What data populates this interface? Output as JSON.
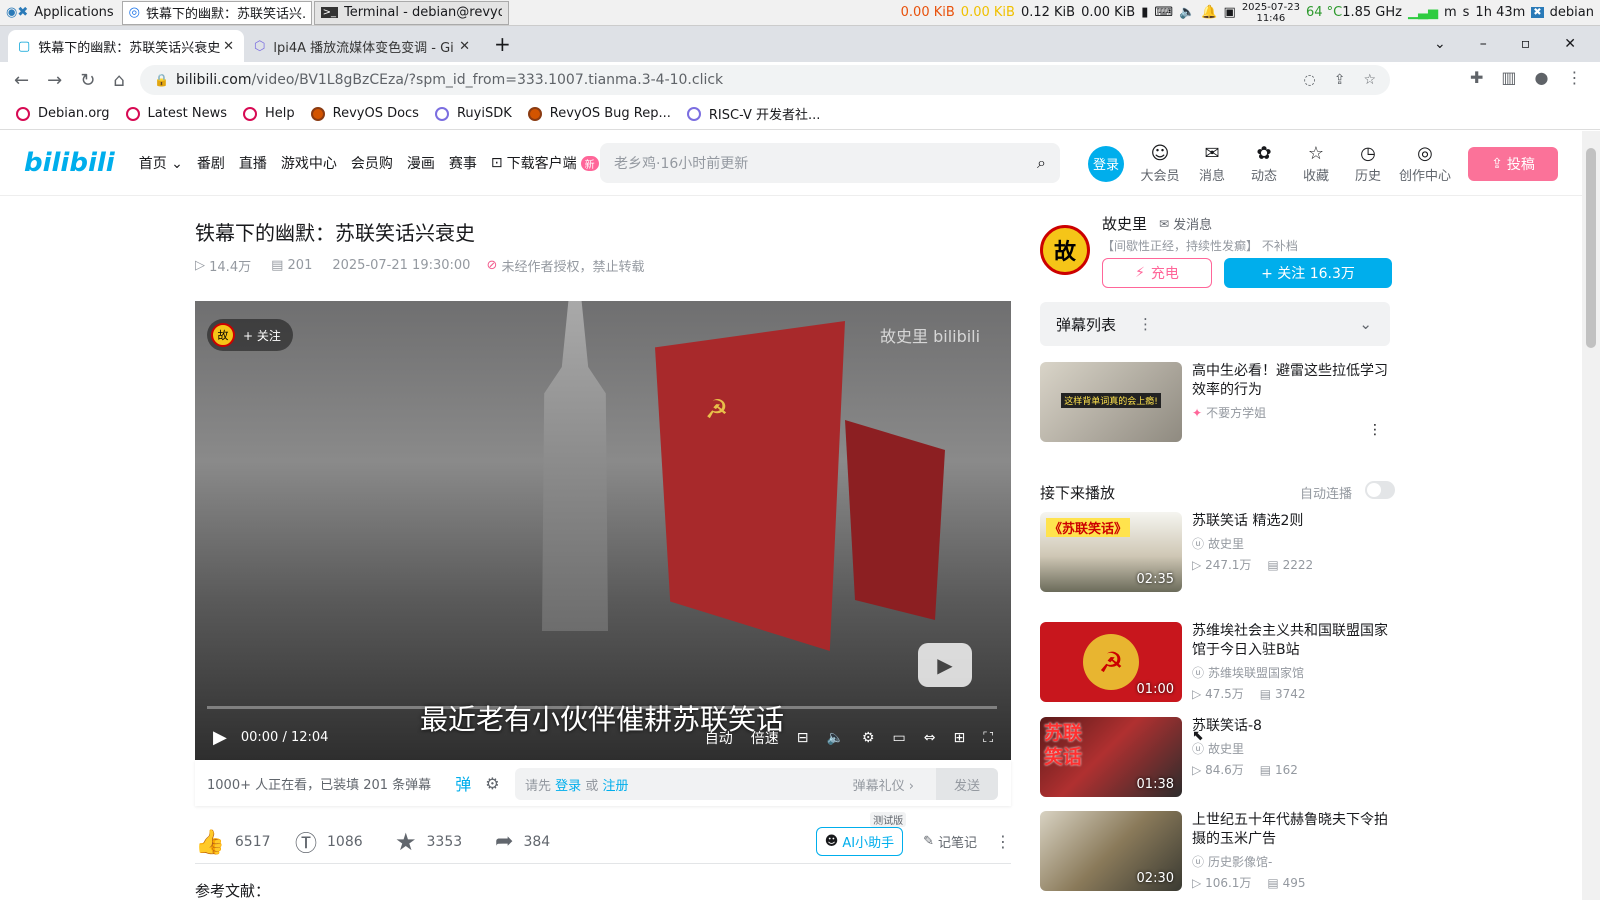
{
  "taskbar": {
    "apps": "Applications",
    "windows": [
      "铁幕下的幽默：苏联笑话兴...",
      "Terminal - debian@revyos..."
    ],
    "net1": "0.00 KiB",
    "net2": "0.00 KiB",
    "net3": "0.12 KiB",
    "net4": "0.00 KiB",
    "date": "2025-07-23",
    "time": "11:46",
    "temp": "64 °C",
    "freq": "1.85 GHz",
    "m": "m",
    "s": "s",
    "battery": "1h 43m",
    "user": "debian"
  },
  "tabs": [
    {
      "title": "铁幕下的幽默：苏联笑话兴衰史"
    },
    {
      "title": "lpi4A 播放流媒体变色变调 - Gi"
    }
  ],
  "url": {
    "host": "bilibili.com",
    "path": "/video/BV1L8gBzCEza/?spm_id_from=333.1007.tianma.3-4-10.click"
  },
  "bookmarks": [
    "Debian.org",
    "Latest News",
    "Help",
    "RevyOS Docs",
    "RuyiSDK",
    "RevyOS Bug Rep...",
    "RISC-V 开发者社..."
  ],
  "bili": {
    "logo": "bilibili",
    "nav": [
      "首页",
      "番剧",
      "直播",
      "游戏中心",
      "会员购",
      "漫画",
      "赛事",
      "下载客户端"
    ],
    "new_badge": "新",
    "search_placeholder": "老乡鸡·16小时前更新",
    "login": "登录",
    "icons": [
      {
        "label": "大会员",
        "glyph": "☺"
      },
      {
        "label": "消息",
        "glyph": "✉"
      },
      {
        "label": "动态",
        "glyph": "✿"
      },
      {
        "label": "收藏",
        "glyph": "☆"
      },
      {
        "label": "历史",
        "glyph": "◷"
      },
      {
        "label": "创作中心",
        "glyph": "◎"
      }
    ],
    "upload": "投稿"
  },
  "video": {
    "title": "铁幕下的幽默：苏联笑话兴衰史",
    "views": "14.4万",
    "danmaku": "201",
    "date": "2025-07-21 19:30:00",
    "copyright": "未经作者授权，禁止转载",
    "follow": "+ 关注",
    "watermark": "故史里 bilibili",
    "subtitle": "最近老有小伙伴催耕苏联笑话",
    "time_now": "00:00",
    "time_sep": "/",
    "time_total": "12:04",
    "ctrl_auto": "自动",
    "ctrl_speed": "倍速",
    "watching": "1000+ 人正在看，已装填 201 条弹幕",
    "dm_prompt": "请先",
    "dm_login": "登录",
    "dm_or": "或",
    "dm_register": "注册",
    "dm_etiquette": "弹幕礼仪 ›",
    "dm_send": "发送",
    "likes": "6517",
    "coins": "1086",
    "favs": "3353",
    "shares": "384",
    "ai": "AI小助手",
    "ai_beta": "测试版",
    "notes": "记笔记",
    "ref": "参考文献："
  },
  "up": {
    "avatar": "故",
    "name": "故史里",
    "msg": "发消息",
    "desc": "【间歇性正经，持续性发癫】 不补档",
    "charge": "充电",
    "follow": "+ 关注 16.3万"
  },
  "dmlist": {
    "label": "弹幕列表"
  },
  "ad": {
    "title": "高中生必看！避雷这些拉低学习效率的行为",
    "author": "不要方学姐",
    "thumb_text": "这样背单词真的会上瘾!"
  },
  "next": {
    "label": "接下来播放",
    "autoplay": "自动连播"
  },
  "recs": [
    {
      "title": "苏联笑话 精选2则",
      "up": "故史里",
      "views": "247.1万",
      "dm": "2222",
      "dur": "02:35",
      "thumb_text": "《苏联笑话》"
    },
    {
      "title": "苏维埃社会主义共和国联盟国家馆于今日入驻B站",
      "up": "苏维埃联盟国家馆",
      "views": "47.5万",
      "dm": "3742",
      "dur": "01:00",
      "thumb_text": ""
    },
    {
      "title": "苏联笑话-8",
      "up": "故史里",
      "views": "84.6万",
      "dm": "162",
      "dur": "01:38",
      "thumb_text": "苏联笑话"
    },
    {
      "title": "上世纪五十年代赫鲁晓夫下令拍摄的玉米广告",
      "up": "历史影像馆-",
      "views": "106.1万",
      "dm": "495",
      "dur": "02:30",
      "thumb_text": ""
    }
  ]
}
